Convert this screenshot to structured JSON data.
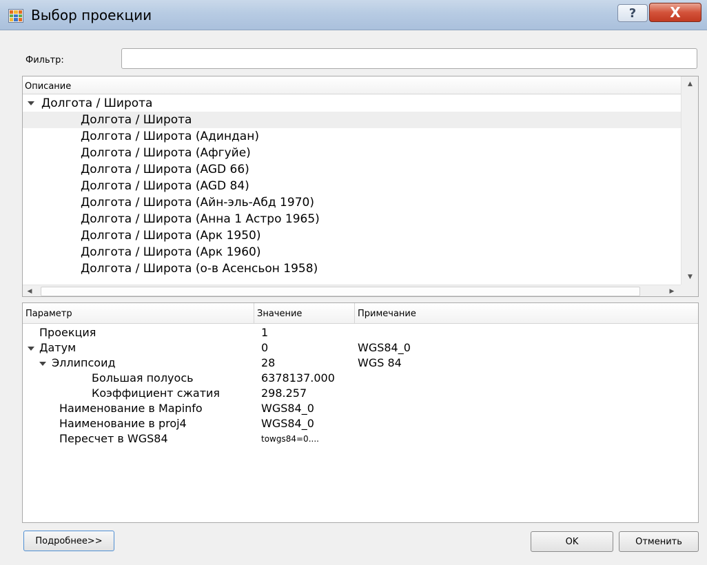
{
  "window": {
    "title": "Выбор проекции",
    "app_icon": "grid-table-icon",
    "help_label": "?",
    "close_label": "X"
  },
  "filter": {
    "label": "Фильтр:",
    "value": "",
    "placeholder": ""
  },
  "tree": {
    "header": "Описание",
    "group_label": "Долгота / Широта",
    "items": [
      "Долгота / Широта",
      "Долгота / Широта (Адиндан)",
      "Долгота / Широта (Афгуйе)",
      "Долгота / Широта (AGD 66)",
      "Долгота / Широта (AGD 84)",
      "Долгота / Широта (Айн-эль-Абд 1970)",
      "Долгота / Широта (Анна 1 Астро 1965)",
      "Долгота / Широта (Арк 1950)",
      "Долгота / Широта (Арк 1960)",
      "Долгота / Широта (о-в Асенсьон 1958)"
    ],
    "selected_index": 0
  },
  "params": {
    "columns": [
      "Параметр",
      "Значение",
      "Примечание"
    ],
    "rows": [
      {
        "name": "Проекция",
        "value": "1",
        "note": ""
      },
      {
        "name": "Датум",
        "value": "0",
        "note": "WGS84_0"
      },
      {
        "name": "Эллипсоид",
        "value": "28",
        "note": "WGS 84"
      },
      {
        "name": "Большая полуось",
        "value": "6378137.000",
        "note": ""
      },
      {
        "name": "Коэффициент сжатия",
        "value": "298.257",
        "note": ""
      },
      {
        "name": "Наименование в Mapinfo",
        "value": "WGS84_0",
        "note": ""
      },
      {
        "name": "Наименование в proj4",
        "value": "WGS84_0",
        "note": ""
      },
      {
        "name": "Пересчет в WGS84",
        "value": "towgs84=0....",
        "note": ""
      }
    ]
  },
  "buttons": {
    "more": "Подробнее>>",
    "ok": "OK",
    "cancel": "Отменить"
  }
}
